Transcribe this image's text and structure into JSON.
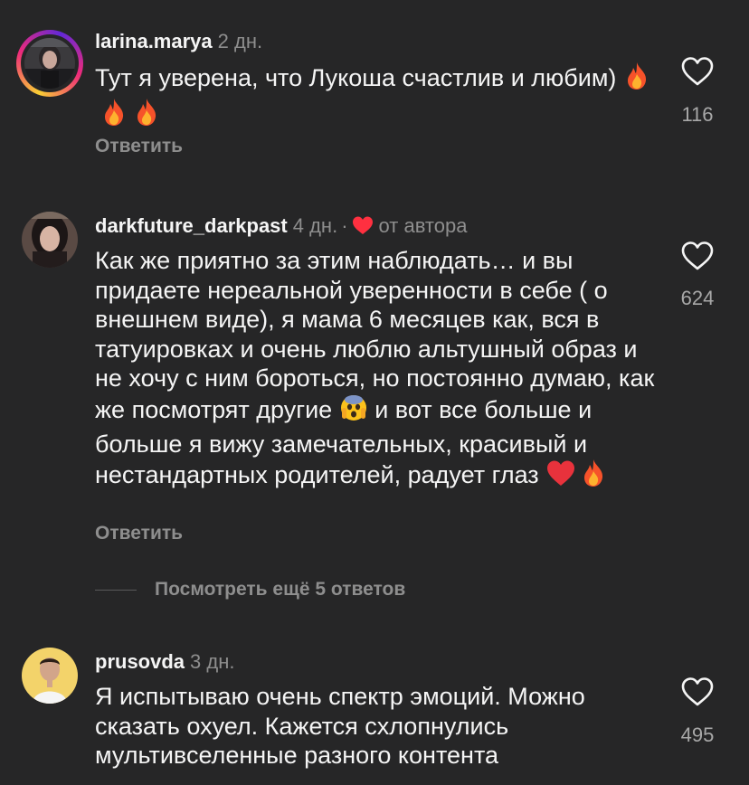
{
  "comments": [
    {
      "username": "larina.marya",
      "time": "2 дн.",
      "text": "Тут я уверена, что Лукоша счастлив и любим)",
      "likes": "116",
      "reply_label": "Ответить",
      "emojis": [
        "fire-icon",
        "fire-icon",
        "fire-icon"
      ]
    },
    {
      "username": "darkfuture_darkpast",
      "time": "4 дн.",
      "separator": "·",
      "author_label": "от автора",
      "text_parts": [
        "Как же приятно за этим наблюдать… и вы придаете нереальной уверенности в себе ( о внешнем виде), я мама 6 месяцев как, вся в татуировках и очень люблю альтушный образ и не хочу с ним бороться, но постоянно думаю, как же посмотрят другие",
        " и вот все больше и больше я вижу замечательных, красивый и нестандартных родителей, радует глаз"
      ],
      "likes": "624",
      "reply_label": "Ответить",
      "emojis": [
        "fearful-face-icon",
        "red-heart-icon",
        "fire-icon"
      ]
    },
    {
      "username": "prusovda",
      "time": "3 дн.",
      "text": "Я испытываю очень спектр эмоций. Можно сказать охуел. Кажется схлопнулись мультивселенные разного контента",
      "likes": "495"
    }
  ],
  "more_replies_label": "Посмотреть ещё 5 ответов",
  "colors": {
    "background": "#262627",
    "text": "#f5f5f5",
    "secondary": "#8e8e8e",
    "author_heart": "#ff3040"
  }
}
